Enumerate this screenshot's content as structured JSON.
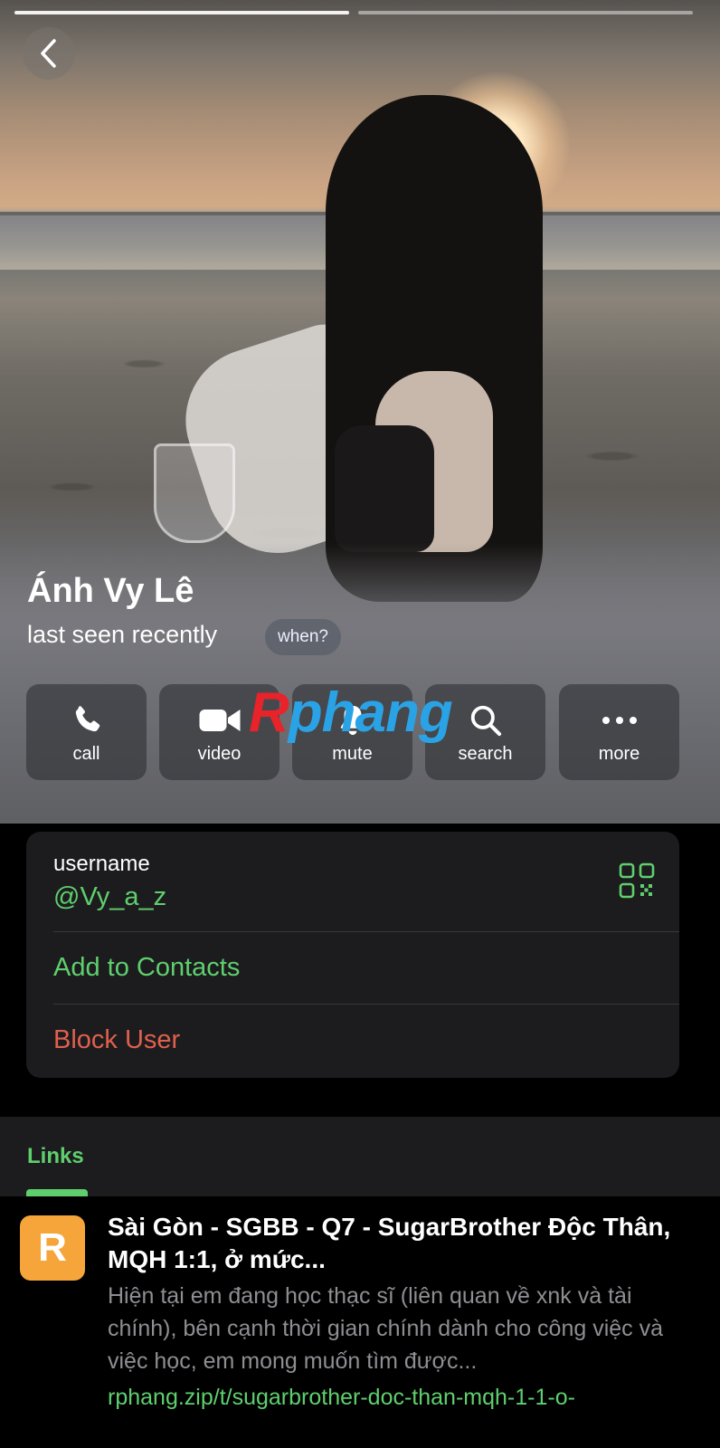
{
  "header": {
    "story_progress": [
      1,
      0
    ],
    "back_icon": "chevron-left-icon"
  },
  "profile": {
    "name": "Ánh Vy Lê",
    "status": "last seen recently",
    "when_label": "when?"
  },
  "actions": [
    {
      "label": "call",
      "icon": "phone-icon"
    },
    {
      "label": "video",
      "icon": "video-camera-icon"
    },
    {
      "label": "mute",
      "icon": "bell-icon"
    },
    {
      "label": "search",
      "icon": "search-icon"
    },
    {
      "label": "more",
      "icon": "more-dots-icon"
    }
  ],
  "watermark": {
    "r": "R",
    "rest": "phang"
  },
  "info": {
    "username_label": "username",
    "username_value": "@Vy_a_z",
    "qr_icon": "qr-code-icon",
    "add_contacts": "Add to Contacts",
    "block_user": "Block User"
  },
  "links": {
    "title": "Links",
    "item": {
      "icon_letter": "R",
      "title": "Sài Gòn - SGBB - Q7 - SugarBrother Độc Thân, MQH 1:1, ở mức...",
      "description": "Hiện tại em đang học thạc sĩ (liên quan về xnk và tài chính), bên cạnh thời gian chính dành cho công việc và việc học, em mong muốn tìm được...",
      "url": "rphang.zip/t/sugarbrother-doc-than-mqh-1-1-o-"
    }
  },
  "colors": {
    "accent_green": "#5fcf6e",
    "destructive_red": "#e0604d",
    "card_bg": "#1c1c1e",
    "link_icon_bg": "#f5a53a"
  }
}
